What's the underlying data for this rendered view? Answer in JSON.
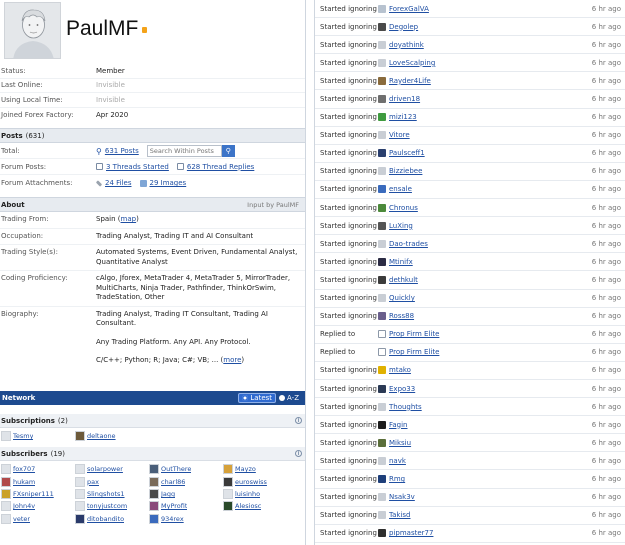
{
  "profile": {
    "username": "PaulMF",
    "flag_color": "#f4a31a"
  },
  "info": [
    {
      "label": "Status:",
      "value": "Member",
      "muted": false
    },
    {
      "label": "Last Online:",
      "value": "Invisible",
      "muted": true
    },
    {
      "label": "Using Local Time:",
      "value": "Invisible",
      "muted": true
    },
    {
      "label": "Joined Forex Factory:",
      "value": "Apr 2020",
      "muted": false
    }
  ],
  "posts": {
    "title": "Posts",
    "count": "(631)",
    "total_label": "Total:",
    "total_posts": "631 Posts",
    "search_placeholder": "Search Within Posts",
    "forum_posts_label": "Forum Posts:",
    "threads_started": "3 Threads Started",
    "thread_replies": "628 Thread Replies",
    "attachments_label": "Forum Attachments:",
    "files": "24 Files",
    "images": "29 Images"
  },
  "about": {
    "title": "About",
    "input_by": "Input by PaulMF",
    "trading_from_label": "Trading From:",
    "trading_from": "Spain",
    "map_link": "map",
    "occupation_label": "Occupation:",
    "occupation": "Trading Analyst, Trading IT and AI Consultant",
    "styles_label": "Trading Style(s):",
    "styles": "Automated Systems, Event Driven, Fundamental Analyst, Quantitative Analyst",
    "coding_label": "Coding Proficiency:",
    "coding": "cAlgo, Jforex, MetaTrader 4, MetaTrader 5, MirrorTrader, MultiCharts, Ninja Trader, Pathfinder, ThinkOrSwim, TradeStation, Other",
    "bio_label": "Biography:",
    "bio_line1": "Trading Analyst, Trading IT Consultant, Trading AI Consultant.",
    "bio_line2": "Any Trading Platform. Any API. Any Protocol.",
    "bio_line3": "C/C++; Python; R; Java; C#; VB; ...",
    "more": "more"
  },
  "network": {
    "title": "Network",
    "opt_latest": "Latest",
    "opt_az": "A-Z",
    "subscriptions_title": "Subscriptions",
    "subscriptions_count": "(2)",
    "subscriptions": [
      "Tesmy",
      "deltaone"
    ],
    "subscribers_title": "Subscribers",
    "subscribers_count": "(19)",
    "subscribers": [
      "fox707",
      "solarpower",
      "OutThere",
      "Mayzo",
      "hukam",
      "pax",
      "charl86",
      "euroswiss",
      "FXsniper111",
      "Slingshots1",
      "Jagg",
      "luisinho",
      "John4v",
      "tonyjustcom",
      "MyProfit",
      "Alesiosc",
      "veter",
      "ditobandito",
      "934rex"
    ]
  },
  "activity": [
    {
      "action": "Started ignoring",
      "name": "ForexGalVA",
      "time": "6 hr ago",
      "color": "#b7c2cf"
    },
    {
      "action": "Started ignoring",
      "name": "Degolep",
      "time": "6 hr ago",
      "color": "#4a4a4a"
    },
    {
      "action": "Started ignoring",
      "name": "doyathink",
      "time": "6 hr ago",
      "color": "#c9ced5"
    },
    {
      "action": "Started ignoring",
      "name": "LoveScalping",
      "time": "6 hr ago",
      "color": "#c9ced5"
    },
    {
      "action": "Started ignoring",
      "name": "Rayder4Life",
      "time": "6 hr ago",
      "color": "#8a6b3c"
    },
    {
      "action": "Started ignoring",
      "name": "driven18",
      "time": "6 hr ago",
      "color": "#6f6f6f"
    },
    {
      "action": "Started ignoring",
      "name": "mizi123",
      "time": "6 hr ago",
      "color": "#3f9b3f"
    },
    {
      "action": "Started ignoring",
      "name": "Vitore",
      "time": "6 hr ago",
      "color": "#c9ced5"
    },
    {
      "action": "Started ignoring",
      "name": "Paulsceff1",
      "time": "6 hr ago",
      "color": "#2a3f6e"
    },
    {
      "action": "Started ignoring",
      "name": "Bizziebee",
      "time": "6 hr ago",
      "color": "#c9ced5"
    },
    {
      "action": "Started ignoring",
      "name": "ensale",
      "time": "6 hr ago",
      "color": "#3a6bbd"
    },
    {
      "action": "Started ignoring",
      "name": "Chronus",
      "time": "6 hr ago",
      "color": "#4c8a3b"
    },
    {
      "action": "Started ignoring",
      "name": "LuXing",
      "time": "6 hr ago",
      "color": "#555555"
    },
    {
      "action": "Started ignoring",
      "name": "Dao-trades",
      "time": "6 hr ago",
      "color": "#c9ced5"
    },
    {
      "action": "Started ignoring",
      "name": "Mtinifx",
      "time": "6 hr ago",
      "color": "#2b2b44"
    },
    {
      "action": "Started ignoring",
      "name": "dethkult",
      "time": "6 hr ago",
      "color": "#3b3b3b"
    },
    {
      "action": "Started ignoring",
      "name": "Quickly",
      "time": "6 hr ago",
      "color": "#c9ced5"
    },
    {
      "action": "Started ignoring",
      "name": "Ross88",
      "time": "6 hr ago",
      "color": "#6a5f8c"
    },
    {
      "action": "Replied to",
      "name": "Prop Firm Elite",
      "time": "6 hr ago",
      "color": "#8c98a8"
    },
    {
      "action": "Replied to",
      "name": "Prop Firm Elite",
      "time": "6 hr ago",
      "color": "#8c98a8"
    },
    {
      "action": "Started ignoring",
      "name": "mtako",
      "time": "6 hr ago",
      "color": "#e0b100"
    },
    {
      "action": "Started ignoring",
      "name": "Expo33",
      "time": "6 hr ago",
      "color": "#2b3a55"
    },
    {
      "action": "Started ignoring",
      "name": "Thoughts",
      "time": "6 hr ago",
      "color": "#c9ced5"
    },
    {
      "action": "Started ignoring",
      "name": "Fagin",
      "time": "6 hr ago",
      "color": "#1c1c1c"
    },
    {
      "action": "Started ignoring",
      "name": "Miksiu",
      "time": "6 hr ago",
      "color": "#5a6e3a"
    },
    {
      "action": "Started ignoring",
      "name": "navk",
      "time": "6 hr ago",
      "color": "#c9ced5"
    },
    {
      "action": "Started ignoring",
      "name": "Rmg",
      "time": "6 hr ago",
      "color": "#1e3f7a"
    },
    {
      "action": "Started ignoring",
      "name": "Nsak3v",
      "time": "6 hr ago",
      "color": "#c9ced5"
    },
    {
      "action": "Started ignoring",
      "name": "Takisd",
      "time": "6 hr ago",
      "color": "#c9ced5"
    },
    {
      "action": "Started ignoring",
      "name": "pipmaster77",
      "time": "6 hr ago",
      "color": "#2e2e2e"
    }
  ]
}
